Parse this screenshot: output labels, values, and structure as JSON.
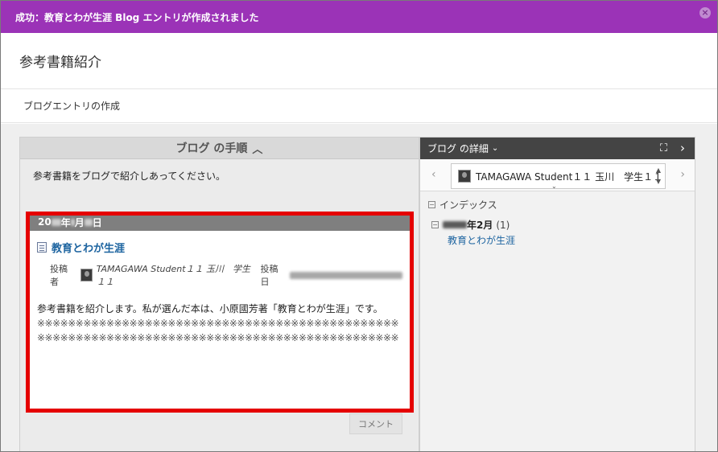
{
  "banner": {
    "message": "成功：教育とわが生涯 Blog エントリが作成されました",
    "close_icon": "close-icon"
  },
  "page": {
    "title": "参考書籍紹介",
    "crumb": "ブログエントリの作成"
  },
  "left_panel": {
    "header": "ブログ の手順",
    "instructions": "参考書籍をブログで紹介しあってください。",
    "entry": {
      "date_prefix": "20",
      "date_year_suffix": "年",
      "date_month_suffix": "月",
      "date_day_suffix": "日",
      "title": "教育とわが生涯",
      "posted_by_label": "投稿者",
      "author": "TAMAGAWA Student１１ 玉川　学生１１",
      "posted_date_label": "投稿日",
      "body_text": "参考書籍を紹介します。私が選んだ本は、小原國芳著「教育とわが生涯」です。",
      "mark_line_1": "※※※※※※※※※※※※※※※※※※※※※※※※※※※※※※※※※※※※※※※※※※※※※※※",
      "mark_line_2": "※※※※※※※※※※※※※※※※※※※※※※※※※※※※※※※※※※※※※※※※※※※※※※※"
    },
    "comment_label": "コメント"
  },
  "right_panel": {
    "header": "ブログ の詳細",
    "user_select": "TAMAGAWA Student１１ 玉川　学生１１",
    "index_label": "インデックス",
    "month_suffix": "年2月",
    "month_count": "(1)",
    "index_link": "教育とわが生涯"
  },
  "colors": {
    "banner": "#9b33b7",
    "link": "#1d64a0",
    "highlight": "#e50000"
  }
}
